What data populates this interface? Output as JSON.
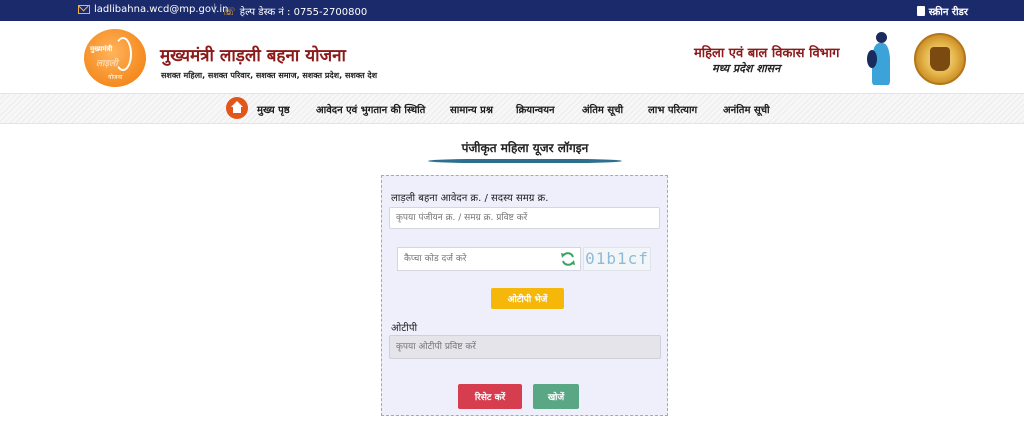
{
  "topbar": {
    "email": "ladlibahna.wcd@mp.gov.in",
    "separator": "|",
    "helpdesk": "हेल्प डेस्क नं : 0755-2700800",
    "screen_reader": "स्क्रीन रीडर"
  },
  "header": {
    "logo_line1": "मुख्यमंत्री",
    "logo_line2": "लाड़ली",
    "logo_line3": "योजना",
    "title": "मुख्यमंत्री लाड़ली बहना योजना",
    "subtitle": "सशक्त महिला, सशक्त परिवार, सशक्त समाज, सशक्त प्रदेश, सशक्त देश",
    "dept_line1": "महिला एवं बाल विकास विभाग",
    "dept_line2": "मध्य प्रदेश शासन"
  },
  "nav": {
    "items": [
      "मुख्य पृष्ठ",
      "आवेदन एवं भुगतान की स्थिति",
      "सामान्य प्रश्न",
      "क्रियान्वयन",
      "अंतिम सूची",
      "लाभ परित्याग",
      "अनंतिम सूची"
    ]
  },
  "login": {
    "heading": "पंजीकृत महिला यूजर लॉगइन",
    "id_label": "लाड़ली बहना आवेदन क्र. / सदस्य समग्र क्र.",
    "id_placeholder": "कृपया पंजीयन क्र. / समग्र क्र. प्रविष्ट करें",
    "captcha_placeholder": "कैप्चा कोड दर्ज करे",
    "captcha_code": "01b1cf",
    "send_otp_label": "ओटीपी भेजें",
    "otp_label": "ओटीपी",
    "otp_placeholder": "कृपया ओटीपी प्रविष्ट करें",
    "reset_label": "रिसेट करें",
    "search_label": "खोजें"
  },
  "colors": {
    "topbar_bg": "#1b2a6b",
    "title_red": "#8b1a1a",
    "accent_orange": "#e2551b",
    "otp_button": "#f5b70a",
    "reset_button": "#d63e4f",
    "search_button": "#5aa786",
    "panel_bg": "#eeeffb"
  },
  "icons": [
    "mail-icon",
    "phone-icon",
    "book-icon",
    "home-icon",
    "refresh-icon"
  ]
}
